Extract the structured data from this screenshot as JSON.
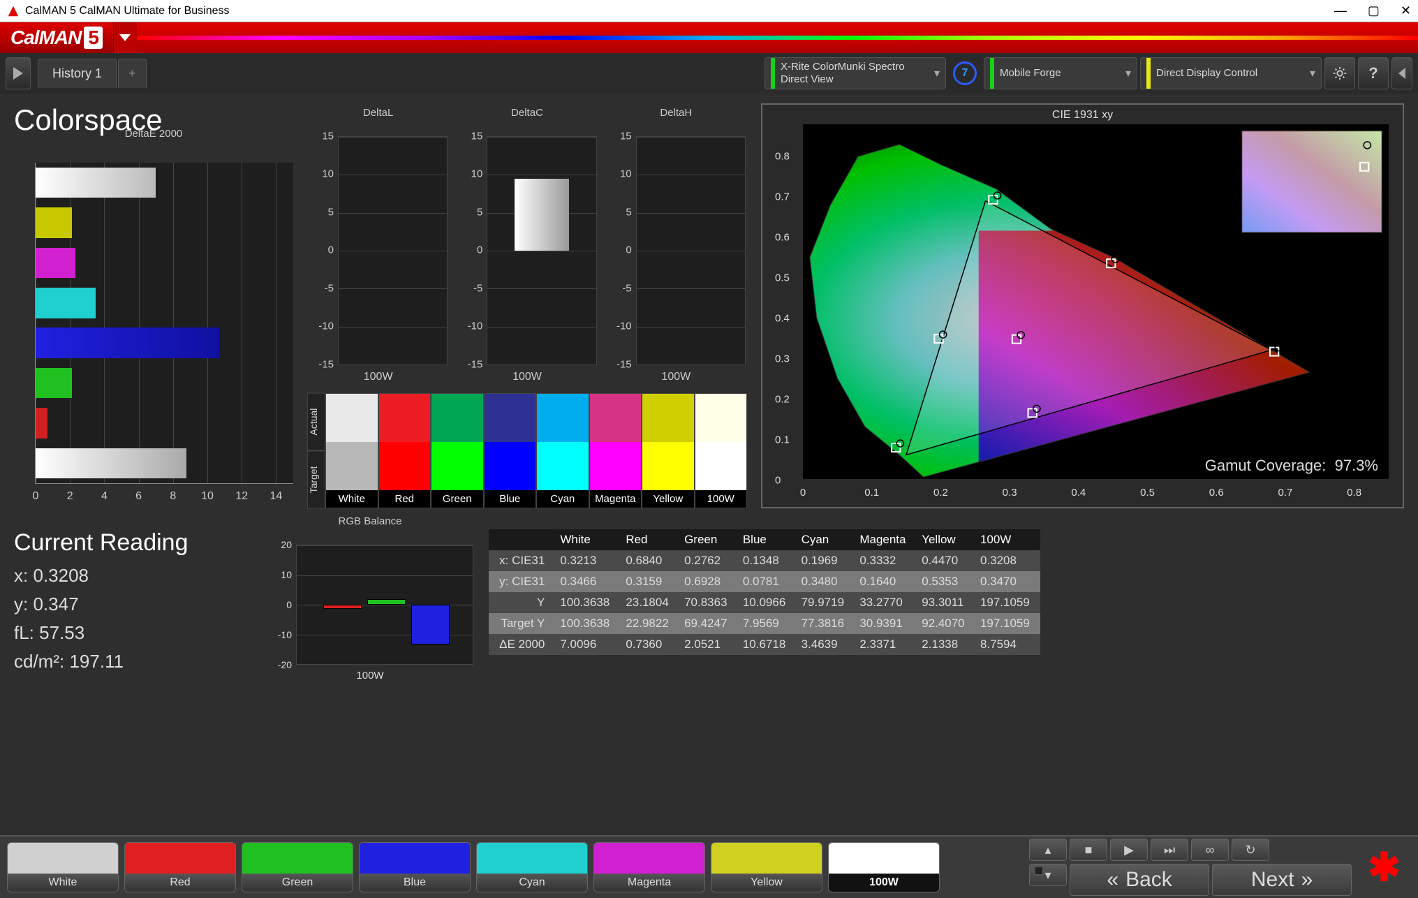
{
  "window": {
    "title": "CalMAN 5 CalMAN Ultimate for Business"
  },
  "brand": "CalMAN",
  "brand_suffix": "5",
  "tabs": {
    "history": "History 1",
    "add": "+"
  },
  "devices": {
    "meter": {
      "line1": "X-Rite ColorMunki Spectro",
      "line2": "Direct View",
      "color": "#18d018"
    },
    "source": {
      "line1": "Mobile Forge",
      "line2": "",
      "color": "#18d018"
    },
    "display": {
      "line1": "Direct Display Control",
      "line2": "",
      "color": "#e8e818"
    },
    "badge": "7"
  },
  "page_title": "Colorspace",
  "chart_titles": {
    "deltae": "DeltaE 2000",
    "deltal": "DeltaL",
    "deltac": "DeltaC",
    "deltah": "DeltaH",
    "cie": "CIE 1931 xy",
    "rgb": "RGB Balance"
  },
  "chart_data": {
    "deltae_2000": {
      "type": "bar",
      "orientation": "horizontal",
      "xlim": [
        0,
        15
      ],
      "xticks": [
        0,
        2,
        4,
        6,
        8,
        10,
        12,
        14
      ],
      "series": [
        {
          "name": "White",
          "value": 7.0,
          "color": "linear-gradient(to right,#fff,#bbb)"
        },
        {
          "name": "Yellow",
          "value": 2.1,
          "color": "#c8c800"
        },
        {
          "name": "Magenta",
          "value": 2.3,
          "color": "#d020d0"
        },
        {
          "name": "Cyan",
          "value": 3.5,
          "color": "#20d0d0"
        },
        {
          "name": "Blue",
          "value": 10.7,
          "color": "linear-gradient(to right,#2020e0,#1010a0)"
        },
        {
          "name": "Green",
          "value": 2.1,
          "color": "#20c020"
        },
        {
          "name": "Red",
          "value": 0.7,
          "color": "#d02020"
        },
        {
          "name": "100W",
          "value": 8.8,
          "color": "linear-gradient(to right,#fff,#aaa)"
        }
      ]
    },
    "small_charts": {
      "ylim": [
        -15,
        15
      ],
      "yticks": [
        -15,
        -10,
        -5,
        0,
        5,
        10,
        15
      ],
      "xlabel": "100W",
      "deltal": [
        {
          "name": "100W",
          "value": 0
        }
      ],
      "deltac": [
        {
          "name": "100W",
          "value": 9.5
        }
      ],
      "deltah": [
        {
          "name": "100W",
          "value": 0
        }
      ]
    },
    "rgb_balance": {
      "type": "bar",
      "ylim": [
        -20,
        20
      ],
      "yticks": [
        -20,
        -10,
        0,
        10,
        20
      ],
      "xlabel": "100W",
      "series": [
        {
          "name": "R",
          "value": -1.5,
          "color": "#e02020"
        },
        {
          "name": "G",
          "value": 2.0,
          "color": "#20c020"
        },
        {
          "name": "B",
          "value": -13.5,
          "color": "#2020e0"
        }
      ]
    },
    "cie_1931": {
      "type": "scatter",
      "xlim": [
        0,
        0.85
      ],
      "ylim": [
        0,
        0.88
      ],
      "xticks": [
        0,
        0.1,
        0.2,
        0.3,
        0.4,
        0.5,
        0.6,
        0.7,
        0.8
      ],
      "yticks": [
        0,
        0.1,
        0.2,
        0.3,
        0.4,
        0.5,
        0.6,
        0.7,
        0.8
      ],
      "target_triangle": [
        [
          0.68,
          0.32
        ],
        [
          0.265,
          0.69
        ],
        [
          0.15,
          0.06
        ]
      ],
      "measured": [
        {
          "name": "Red",
          "x": 0.684,
          "y": 0.316
        },
        {
          "name": "Green",
          "x": 0.276,
          "y": 0.693
        },
        {
          "name": "Blue",
          "x": 0.135,
          "y": 0.078
        },
        {
          "name": "Cyan",
          "x": 0.197,
          "y": 0.348
        },
        {
          "name": "Magenta",
          "x": 0.333,
          "y": 0.164
        },
        {
          "name": "Yellow",
          "x": 0.447,
          "y": 0.535
        },
        {
          "name": "White",
          "x": 0.31,
          "y": 0.347
        }
      ]
    }
  },
  "swatches": {
    "sidelabels": {
      "actual": "Actual",
      "target": "Target"
    },
    "cols": [
      {
        "label": "White",
        "actual": "#e8e8e8",
        "target": "#b8b8b8"
      },
      {
        "label": "Red",
        "actual": "#ec1c24",
        "target": "#ff0000"
      },
      {
        "label": "Green",
        "actual": "#00a651",
        "target": "#00ff00"
      },
      {
        "label": "Blue",
        "actual": "#2e3192",
        "target": "#0000ff"
      },
      {
        "label": "Cyan",
        "actual": "#00aeef",
        "target": "#00ffff"
      },
      {
        "label": "Magenta",
        "actual": "#d63384",
        "target": "#ff00ff"
      },
      {
        "label": "Yellow",
        "actual": "#d0d000",
        "target": "#ffff00"
      },
      {
        "label": "100W",
        "actual": "#ffffe8",
        "target": "#ffffff"
      }
    ]
  },
  "gamut_label": "Gamut Coverage:",
  "gamut_value": "97.3%",
  "current_reading": {
    "title": "Current Reading",
    "x_label": "x:",
    "x_value": "0.3208",
    "y_label": "y:",
    "y_value": "0.347",
    "fl_label": "fL:",
    "fl_value": "57.53",
    "cd_label": "cd/m²:",
    "cd_value": "197.11"
  },
  "table": {
    "headers": [
      "",
      "White",
      "Red",
      "Green",
      "Blue",
      "Cyan",
      "Magenta",
      "Yellow",
      "100W"
    ],
    "rows": [
      [
        "x: CIE31",
        "0.3213",
        "0.6840",
        "0.2762",
        "0.1348",
        "0.1969",
        "0.3332",
        "0.4470",
        "0.3208"
      ],
      [
        "y: CIE31",
        "0.3466",
        "0.3159",
        "0.6928",
        "0.0781",
        "0.3480",
        "0.1640",
        "0.5353",
        "0.3470"
      ],
      [
        "Y",
        "100.3638",
        "23.1804",
        "70.8363",
        "10.0966",
        "79.9719",
        "33.2770",
        "93.3011",
        "197.1059"
      ],
      [
        "Target Y",
        "100.3638",
        "22.9822",
        "69.4247",
        "7.9569",
        "77.3816",
        "30.9391",
        "92.4070",
        "197.1059"
      ],
      [
        "ΔE 2000",
        "7.0096",
        "0.7360",
        "2.0521",
        "10.6718",
        "3.4639",
        "2.3371",
        "2.1338",
        "8.7594"
      ]
    ]
  },
  "bottom_colors": [
    {
      "label": "White",
      "color": "#d0d0d0"
    },
    {
      "label": "Red",
      "color": "#e02020"
    },
    {
      "label": "Green",
      "color": "#20c020"
    },
    {
      "label": "Blue",
      "color": "#2020e0"
    },
    {
      "label": "Cyan",
      "color": "#20d0d0"
    },
    {
      "label": "Magenta",
      "color": "#d020d0"
    },
    {
      "label": "Yellow",
      "color": "#d0d020"
    },
    {
      "label": "100W",
      "color": "#ffffff",
      "active": true
    }
  ],
  "nav": {
    "back": "Back",
    "next": "Next"
  }
}
